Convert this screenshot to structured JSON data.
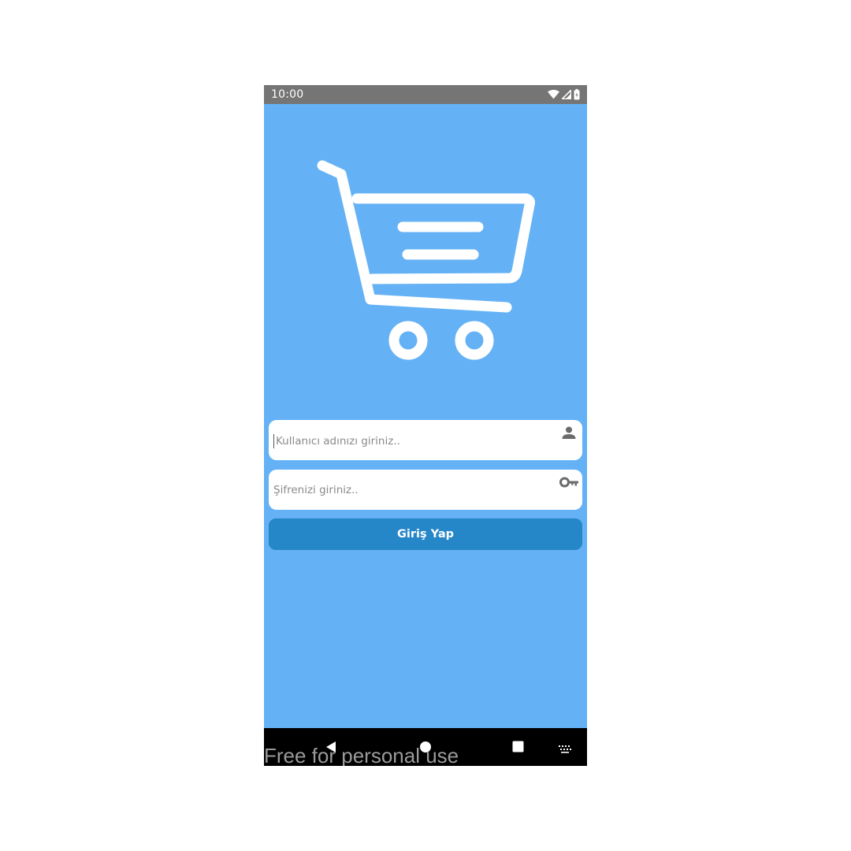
{
  "status_bar": {
    "time": "10:00",
    "icons": [
      "wifi-icon",
      "cellular-signal-icon",
      "battery-icon"
    ],
    "background": "#757575"
  },
  "app": {
    "background": "#64b2f5",
    "logo_icon": "shopping-cart-icon",
    "username_field": {
      "placeholder": "Kullanıcı adınızı giriniz..",
      "value": "",
      "icon": "person-icon"
    },
    "password_field": {
      "placeholder": "Şifrenizi giriniz..",
      "value": "",
      "icon": "key-icon"
    },
    "login_button": {
      "label": "Giriş Yap",
      "color": "#2586c8"
    }
  },
  "nav_bar": {
    "buttons": [
      "back-icon",
      "home-icon",
      "recents-icon",
      "keyboard-icon"
    ]
  },
  "watermark": {
    "text": "Free for personal use"
  }
}
